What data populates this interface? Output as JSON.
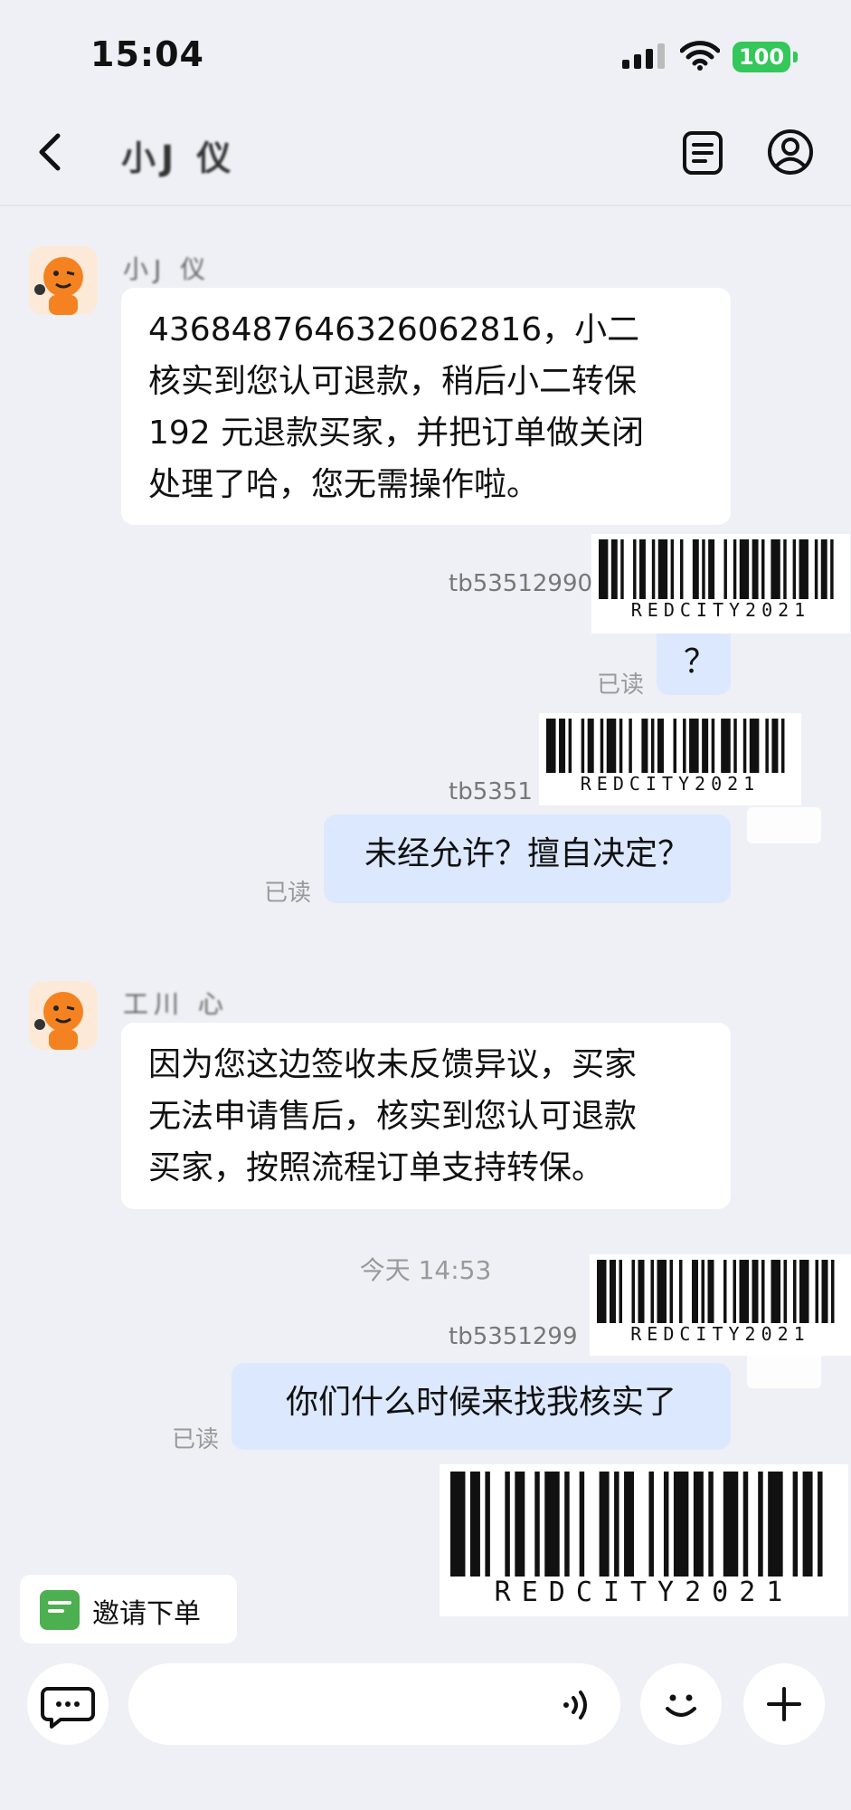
{
  "status_bar": {
    "time": "15:04",
    "battery": "100"
  },
  "nav": {
    "title": "小J 仪"
  },
  "messages": {
    "m1": {
      "sender": "小J 仪",
      "text_lines": [
        "4368487646326062816，小二",
        "核实到您认可退款，稍后小二转保",
        "192 元退款买家，并把订单做关闭",
        "处理了哈，您无需操作啦。"
      ]
    },
    "m2": {
      "user": "tb53512990",
      "text": "？",
      "read": "已读"
    },
    "m3": {
      "user": "tb5351",
      "text": "未经允许？擅自决定？",
      "read": "已读"
    },
    "m4": {
      "sender": "工川 心",
      "text_lines": [
        "因为您这边签收未反馈异议，买家",
        "无法申请售后，核实到您认可退款",
        "买家，按照流程订单支持转保。"
      ]
    },
    "time_divider": "今天 14:53",
    "m5": {
      "user": "tb5351299",
      "text": "你们什么时候来找我核实了",
      "read": "已读"
    }
  },
  "watermark": {
    "code": "REDCITY2021"
  },
  "bottom": {
    "invite_label": "邀请下单",
    "icons": {
      "chat": "chat-bubble-icon",
      "voice": "voice-icon",
      "emoji": "emoji-icon",
      "plus": "plus-icon"
    }
  },
  "colors": {
    "accent_battery": "#34c759",
    "right_bubble": "#dce8fd",
    "background": "#eef0f5"
  }
}
